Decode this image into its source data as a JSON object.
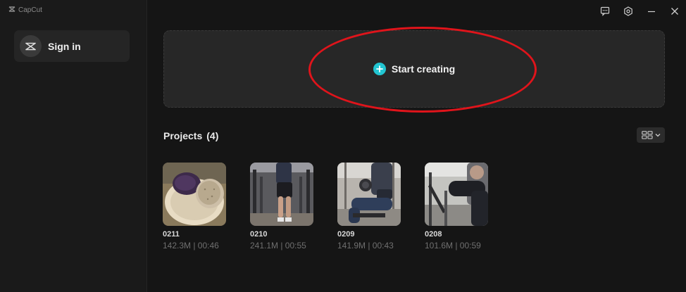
{
  "app": {
    "brand": "CapCut"
  },
  "sidebar": {
    "sign_in": "Sign in"
  },
  "main": {
    "start_creating": "Start creating",
    "projects_label": "Projects",
    "projects_count": "(4)"
  },
  "projects": [
    {
      "name": "0211",
      "meta": "142.3M | 00:46"
    },
    {
      "name": "0210",
      "meta": "241.1M | 00:55"
    },
    {
      "name": "0209",
      "meta": "141.9M | 00:43"
    },
    {
      "name": "0208",
      "meta": "101.6M | 00:59"
    }
  ],
  "colors": {
    "accent": "#22c5d1",
    "annotation": "#e0141b",
    "background": "#151515",
    "sidebar": "#1a1a1a"
  }
}
